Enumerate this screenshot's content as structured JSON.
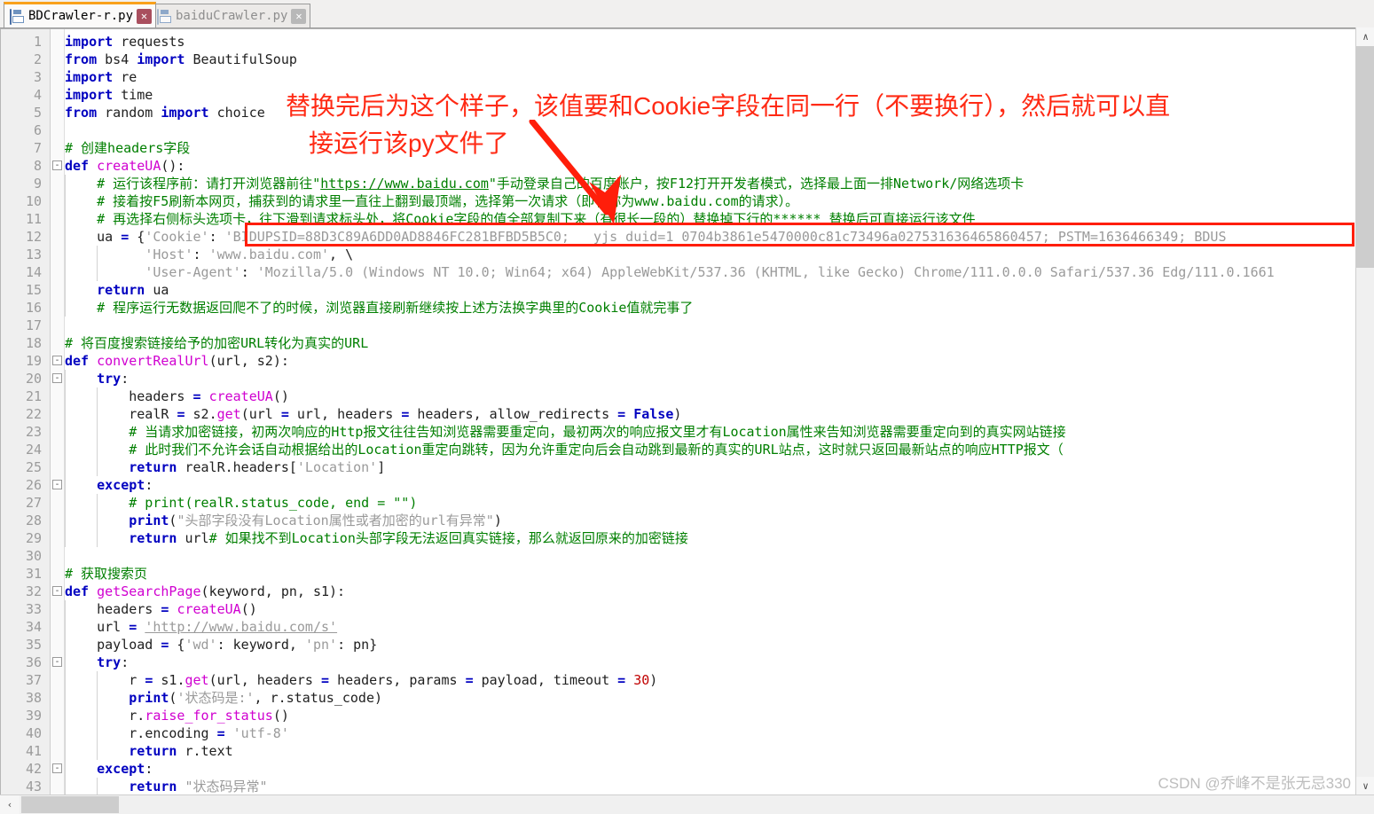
{
  "window": {
    "accent_color": "#f9a11b",
    "annotation_color": "#ff2a14"
  },
  "tabs": [
    {
      "label": "BDCrawler-r.py",
      "icon": "floppy-disk-icon",
      "close": "✕",
      "active": true
    },
    {
      "label": "baiduCrawler.py",
      "icon": "floppy-disk-icon",
      "close": "✕",
      "active": false
    }
  ],
  "annotation": {
    "line1": "替换完后为这个样子，该值要和Cookie字段在同一行（不要换行），然后就可以直",
    "line2": "接运行该py文件了"
  },
  "watermark": "CSDN @乔峰不是张无忌330",
  "scrollbars": {
    "v_up": "∧",
    "v_down": "∨",
    "h_left": "‹"
  },
  "editor": {
    "lines": [
      {
        "n": 1,
        "fold": "",
        "code": "import requests"
      },
      {
        "n": 2,
        "fold": "",
        "code": "from bs4 import BeautifulSoup"
      },
      {
        "n": 3,
        "fold": "",
        "code": "import re"
      },
      {
        "n": 4,
        "fold": "",
        "code": "import time"
      },
      {
        "n": 5,
        "fold": "",
        "code": "from random import choice"
      },
      {
        "n": 6,
        "fold": "",
        "code": ""
      },
      {
        "n": 7,
        "fold": "",
        "code": "# 创建headers字段"
      },
      {
        "n": 8,
        "fold": "-",
        "code": "def createUA():"
      },
      {
        "n": 9,
        "fold": "",
        "code": "    # 运行该程序前：请打开浏览器前往\"https://www.baidu.com\"手动登录自己的百度账户，按F12打开开发者模式，选择最上面一排Network/网络选项卡"
      },
      {
        "n": 10,
        "fold": "",
        "code": "    # 接着按F5刷新本网页，捕获到的请求里一直往上翻到最顶端，选择第一次请求（即名称为www.baidu.com的请求）。"
      },
      {
        "n": 11,
        "fold": "",
        "code": "    # 再选择右侧标头选项卡，往下滑到请求标头处，将Cookie字段的值全部复制下来（有很长一段的）替换掉下行的****** 替换后可直接运行该文件"
      },
      {
        "n": 12,
        "fold": "",
        "code": "    ua = {'Cookie': 'BIDUPSID=88D3C89A6DD0AD8846FC281BFBD5B5C0; __yjs_duid=1_0704b3861e5470000c81c73496a027531636465860457; PSTM=1636466349; BDUS"
      },
      {
        "n": 13,
        "fold": "",
        "code": "          'Host': 'www.baidu.com', \\"
      },
      {
        "n": 14,
        "fold": "",
        "code": "          'User-Agent': 'Mozilla/5.0 (Windows NT 10.0; Win64; x64) AppleWebKit/537.36 (KHTML, like Gecko) Chrome/111.0.0.0 Safari/537.36 Edg/111.0.1661"
      },
      {
        "n": 15,
        "fold": "",
        "code": "    return ua"
      },
      {
        "n": 16,
        "fold": "",
        "code": "    # 程序运行无数据返回爬不了的时候，浏览器直接刷新继续按上述方法换字典里的Cookie值就完事了"
      },
      {
        "n": 17,
        "fold": "",
        "code": ""
      },
      {
        "n": 18,
        "fold": "",
        "code": "# 将百度搜索链接给予的加密URL转化为真实的URL"
      },
      {
        "n": 19,
        "fold": "-",
        "code": "def convertRealUrl(url, s2):"
      },
      {
        "n": 20,
        "fold": "-",
        "code": "    try:"
      },
      {
        "n": 21,
        "fold": "",
        "code": "        headers = createUA()"
      },
      {
        "n": 22,
        "fold": "",
        "code": "        realR = s2.get(url = url, headers = headers, allow_redirects = False)"
      },
      {
        "n": 23,
        "fold": "",
        "code": "        # 当请求加密链接，初两次响应的Http报文往往告知浏览器需要重定向，最初两次的响应报文里才有Location属性来告知浏览器需要重定向到的真实网站链接"
      },
      {
        "n": 24,
        "fold": "",
        "code": "        # 此时我们不允许会话自动根据给出的Location重定向跳转，因为允许重定向后会自动跳到最新的真实的URL站点，这时就只返回最新站点的响应HTTP报文（"
      },
      {
        "n": 25,
        "fold": "",
        "code": "        return realR.headers['Location']"
      },
      {
        "n": 26,
        "fold": "-",
        "code": "    except:"
      },
      {
        "n": 27,
        "fold": "",
        "code": "        # print(realR.status_code, end = \"\")"
      },
      {
        "n": 28,
        "fold": "",
        "code": "        print(\"头部字段没有Location属性或者加密的url有异常\")"
      },
      {
        "n": 29,
        "fold": "",
        "code": "        return url# 如果找不到Location头部字段无法返回真实链接，那么就返回原来的加密链接"
      },
      {
        "n": 30,
        "fold": "",
        "code": ""
      },
      {
        "n": 31,
        "fold": "",
        "code": "# 获取搜索页"
      },
      {
        "n": 32,
        "fold": "-",
        "code": "def getSearchPage(keyword, pn, s1):"
      },
      {
        "n": 33,
        "fold": "",
        "code": "    headers = createUA()"
      },
      {
        "n": 34,
        "fold": "",
        "code": "    url = 'http://www.baidu.com/s'"
      },
      {
        "n": 35,
        "fold": "",
        "code": "    payload = {'wd': keyword, 'pn': pn}"
      },
      {
        "n": 36,
        "fold": "-",
        "code": "    try:"
      },
      {
        "n": 37,
        "fold": "",
        "code": "        r = s1.get(url, headers = headers, params = payload, timeout = 30)"
      },
      {
        "n": 38,
        "fold": "",
        "code": "        print('状态码是:', r.status_code)"
      },
      {
        "n": 39,
        "fold": "",
        "code": "        r.raise_for_status()"
      },
      {
        "n": 40,
        "fold": "",
        "code": "        r.encoding = 'utf-8'"
      },
      {
        "n": 41,
        "fold": "",
        "code": "        return r.text"
      },
      {
        "n": 42,
        "fold": "-",
        "code": "    except:"
      },
      {
        "n": 43,
        "fold": "",
        "code": "        return \"状态码异常\""
      }
    ]
  }
}
